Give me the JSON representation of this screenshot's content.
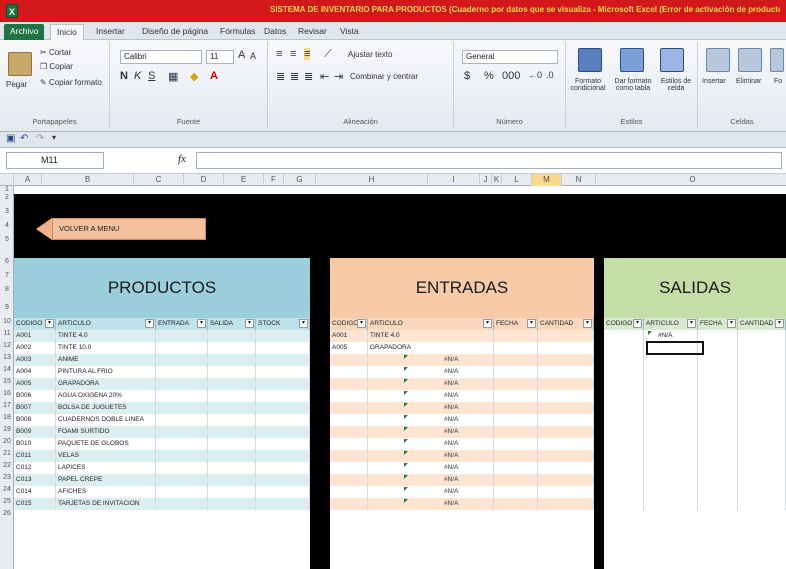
{
  "window": {
    "title": "SISTEMA DE INVENTARIO PARA PRODUCTOS (Cuaderno por datos que se visualiza - Microsoft Excel (Error de activación de productos)"
  },
  "ribbon_tabs": [
    "Archivo",
    "Inicio",
    "Insertar",
    "Diseño de página",
    "Fórmulas",
    "Datos",
    "Revisar",
    "Vista"
  ],
  "ribbon": {
    "clipboard": {
      "paste": "Pegar",
      "cut": "Cortar",
      "copy": "Copiar",
      "format_painter": "Copiar formato",
      "label": "Portapapeles"
    },
    "font": {
      "name": "Calibri",
      "size": "11",
      "label": "Fuente"
    },
    "alignment": {
      "wrap": "Ajustar texto",
      "merge": "Combinar y centrar",
      "label": "Alineación"
    },
    "number": {
      "format": "General",
      "label": "Número"
    },
    "styles": {
      "conditional": "Formato condicional",
      "as_table": "Dar formato como tabla",
      "cell_styles": "Estilos de celda",
      "label": "Estilos"
    },
    "cells": {
      "insert": "Insertar",
      "delete": "Eliminar",
      "format": "Fo",
      "label": "Celdas"
    }
  },
  "formula_bar": {
    "name_box": "M11",
    "fx": "fx",
    "formula": ""
  },
  "columns": [
    "A",
    "B",
    "C",
    "D",
    "E",
    "F",
    "G",
    "H",
    "I",
    "J",
    "K",
    "L",
    "M",
    "N",
    "O"
  ],
  "selected_column": "M",
  "row_numbers": [
    "1",
    "2",
    "3",
    "4",
    "5",
    "6",
    "7",
    "8",
    "9",
    "10",
    "11",
    "12",
    "13",
    "14",
    "15",
    "16",
    "17",
    "18",
    "19",
    "20",
    "21",
    "22",
    "23",
    "24",
    "25",
    "26"
  ],
  "back_button": "VOLVER A MENU",
  "sections": {
    "productos": "PRODUCTOS",
    "entradas": "ENTRADAS",
    "salidas": "SALIDAS"
  },
  "productos_table": {
    "headers": [
      "CODIGO",
      "ARTICULO",
      "ENTRADA",
      "SALIDA",
      "STOCK"
    ],
    "rows": [
      [
        "A001",
        "TINTE 4.0"
      ],
      [
        "A002",
        "TINTE 10.0"
      ],
      [
        "A003",
        "ANIME"
      ],
      [
        "A004",
        "PINTURA AL FRIO"
      ],
      [
        "A005",
        "GRAPADORA"
      ],
      [
        "B006",
        "AGUA OXIGENA 20%"
      ],
      [
        "B007",
        "BOLSA DE JUGUETES"
      ],
      [
        "B008",
        "CUADERNOS DOBLE LINEA"
      ],
      [
        "B009",
        "FOAMI SURTIDO"
      ],
      [
        "B010",
        "PAQUETE DE GLOBOS"
      ],
      [
        "C011",
        "VELAS"
      ],
      [
        "C012",
        "LAPICES"
      ],
      [
        "C013",
        "PAPEL CREPE"
      ],
      [
        "C014",
        "AFICHES"
      ],
      [
        "C015",
        "TARJETAS DE INVITACION"
      ]
    ]
  },
  "entradas_table": {
    "headers": [
      "CODIGO",
      "ARTICULO",
      "FECHA",
      "CANTIDAD"
    ],
    "rows": [
      [
        "A001",
        "TINTE 4.0"
      ],
      [
        "A005",
        "GRAPADORA"
      ],
      [
        "",
        "#N/A"
      ],
      [
        "",
        "#N/A"
      ],
      [
        "",
        "#N/A"
      ],
      [
        "",
        "#N/A"
      ],
      [
        "",
        "#N/A"
      ],
      [
        "",
        "#N/A"
      ],
      [
        "",
        "#N/A"
      ],
      [
        "",
        "#N/A"
      ],
      [
        "",
        "#N/A"
      ],
      [
        "",
        "#N/A"
      ],
      [
        "",
        "#N/A"
      ],
      [
        "",
        "#N/A"
      ],
      [
        "",
        "#N/A"
      ]
    ]
  },
  "salidas_table": {
    "headers": [
      "CODIGO",
      "ARTICULO",
      "FECHA",
      "CANTIDAD"
    ],
    "rows": [
      [
        "",
        "#N/A"
      ]
    ]
  }
}
